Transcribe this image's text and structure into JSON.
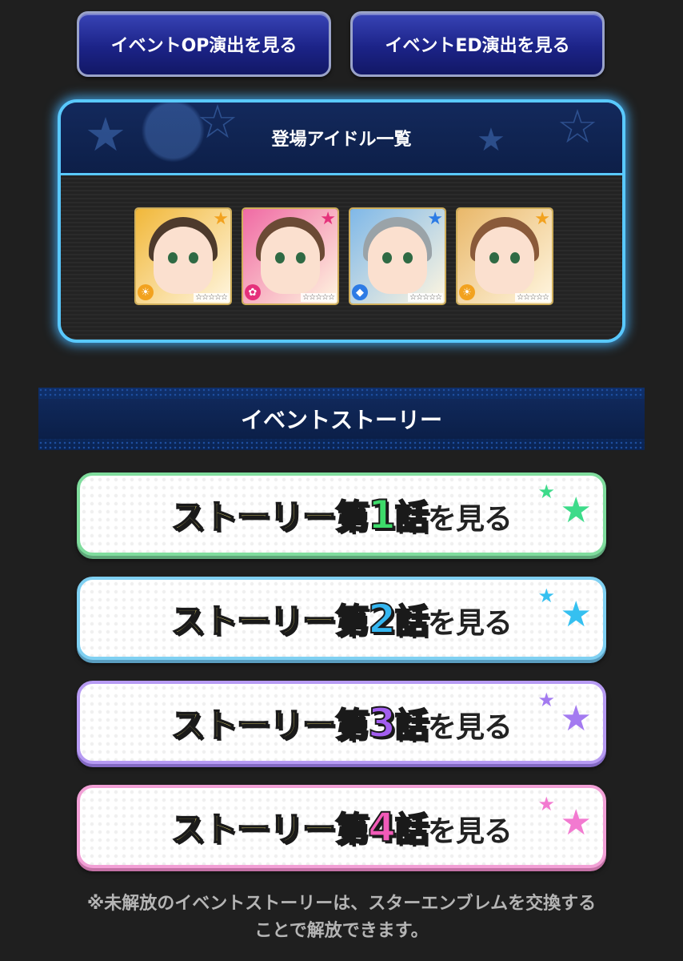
{
  "top_buttons": {
    "op_label": "イベントOP演出を見る",
    "ed_label": "イベントED演出を見る"
  },
  "idol_panel": {
    "title": "登場アイドル一覧",
    "cards": [
      {
        "star_color": "#f2a21f",
        "type_icon": "sun-icon",
        "type_color": "#f2a21f",
        "hair_color": "#4d3a2c",
        "bg": "#f1b83a"
      },
      {
        "star_color": "#e5317b",
        "type_icon": "flower-icon",
        "type_color": "#e5317b",
        "hair_color": "#6b4a35",
        "bg": "#f06aa4"
      },
      {
        "star_color": "#2c7be5",
        "type_icon": "diamond-icon",
        "type_color": "#2c7be5",
        "hair_color": "#9aa3a8",
        "bg": "#7fb8e8"
      },
      {
        "star_color": "#f2a21f",
        "type_icon": "sun-icon",
        "type_color": "#f2a21f",
        "hair_color": "#8a5a3a",
        "bg": "#e9b86a"
      }
    ]
  },
  "story_section": {
    "title": "イベントストーリー",
    "buttons": [
      {
        "prefix": "ストーリー第",
        "number": "1",
        "suffix": "話",
        "tail": "を見る",
        "number_color": "#3ddb6a",
        "star_color": "#3ddb8a"
      },
      {
        "prefix": "ストーリー第",
        "number": "2",
        "suffix": "話",
        "tail": "を見る",
        "number_color": "#35b6f0",
        "star_color": "#35c0f0"
      },
      {
        "prefix": "ストーリー第",
        "number": "3",
        "suffix": "話",
        "tail": "を見る",
        "number_color": "#a35ef0",
        "star_color": "#a37af0"
      },
      {
        "prefix": "ストーリー第",
        "number": "4",
        "suffix": "話",
        "tail": "を見る",
        "number_color": "#f25ab8",
        "star_color": "#f27ad0"
      }
    ]
  },
  "note": {
    "line1": "※未解放のイベントストーリーは、スターエンブレムを交換する",
    "line2": "ことで解放できます。"
  }
}
